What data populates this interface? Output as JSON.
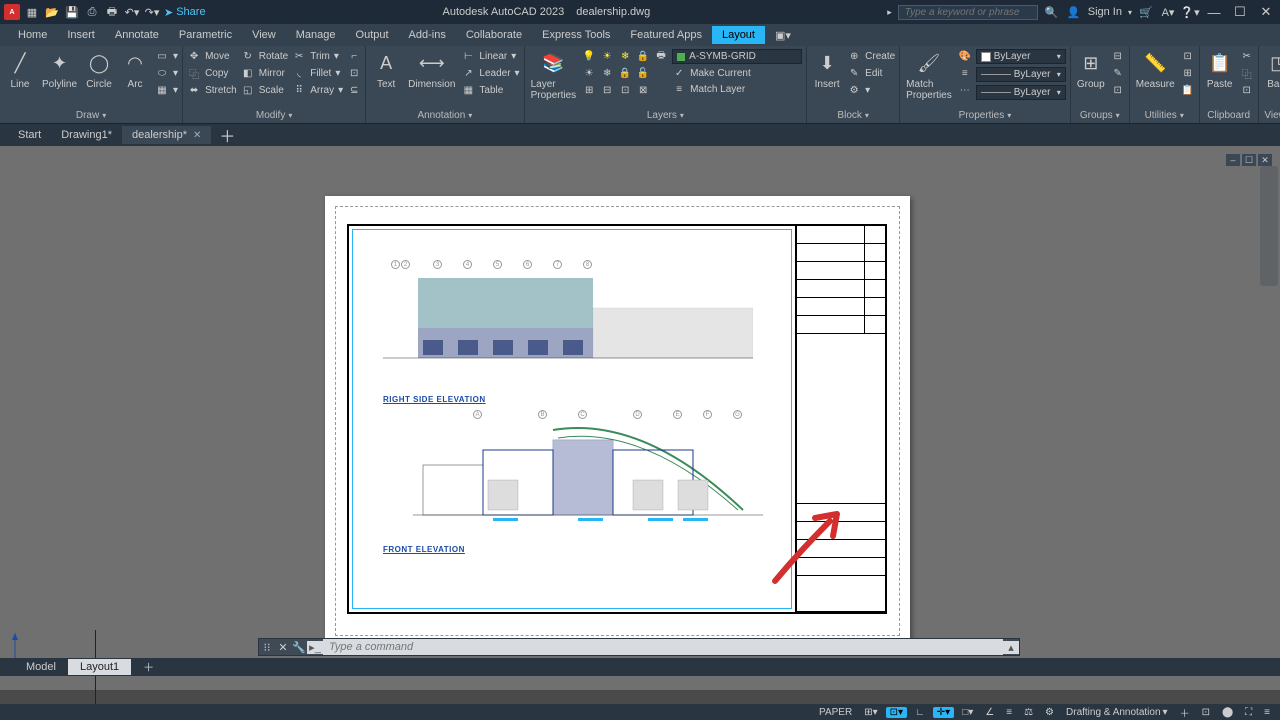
{
  "titlebar": {
    "app_abbrev": "A",
    "share": "Share",
    "product": "Autodesk AutoCAD 2023",
    "filename": "dealership.dwg",
    "search_placeholder": "Type a keyword or phrase",
    "signin": "Sign In"
  },
  "menu": {
    "items": [
      "Home",
      "Insert",
      "Annotate",
      "Parametric",
      "View",
      "Manage",
      "Output",
      "Add-ins",
      "Collaborate",
      "Express Tools",
      "Featured Apps",
      "Layout"
    ],
    "active": "Layout"
  },
  "ribbon": {
    "draw": {
      "title": "Draw",
      "line": "Line",
      "polyline": "Polyline",
      "circle": "Circle",
      "arc": "Arc"
    },
    "modify": {
      "title": "Modify",
      "move": "Move",
      "copy": "Copy",
      "stretch": "Stretch",
      "rotate": "Rotate",
      "mirror": "Mirror",
      "scale": "Scale",
      "trim": "Trim",
      "fillet": "Fillet",
      "array": "Array"
    },
    "annotation": {
      "title": "Annotation",
      "text": "Text",
      "dimension": "Dimension",
      "linear": "Linear",
      "leader": "Leader",
      "table": "Table"
    },
    "layers": {
      "title": "Layers",
      "props": "Layer\nProperties",
      "current_layer": "A-SYMB-GRID",
      "make_current": "Make Current",
      "match": "Match Layer"
    },
    "block": {
      "title": "Block",
      "insert": "Insert",
      "create": "Create",
      "edit": "Edit"
    },
    "properties": {
      "title": "Properties",
      "match": "Match\nProperties",
      "bylayer1": "ByLayer",
      "bylayer2": "ByLayer",
      "bylayer3": "ByLayer"
    },
    "groups": {
      "title": "Groups",
      "group": "Group"
    },
    "utilities": {
      "title": "Utilities",
      "measure": "Measure"
    },
    "clipboard": {
      "title": "Clipboard",
      "paste": "Paste"
    },
    "view": {
      "title": "View",
      "base": "Base"
    }
  },
  "doctabs": {
    "start": "Start",
    "d1": "Drawing1*",
    "d2": "dealership*"
  },
  "drawing": {
    "elev1": "RIGHT SIDE ELEVATION",
    "elev2": "FRONT ELEVATION"
  },
  "cmdline": {
    "placeholder": "Type a command"
  },
  "bottomtabs": {
    "model": "Model",
    "layout1": "Layout1"
  },
  "status": {
    "space": "PAPER",
    "workspace": "Drafting & Annotation"
  }
}
